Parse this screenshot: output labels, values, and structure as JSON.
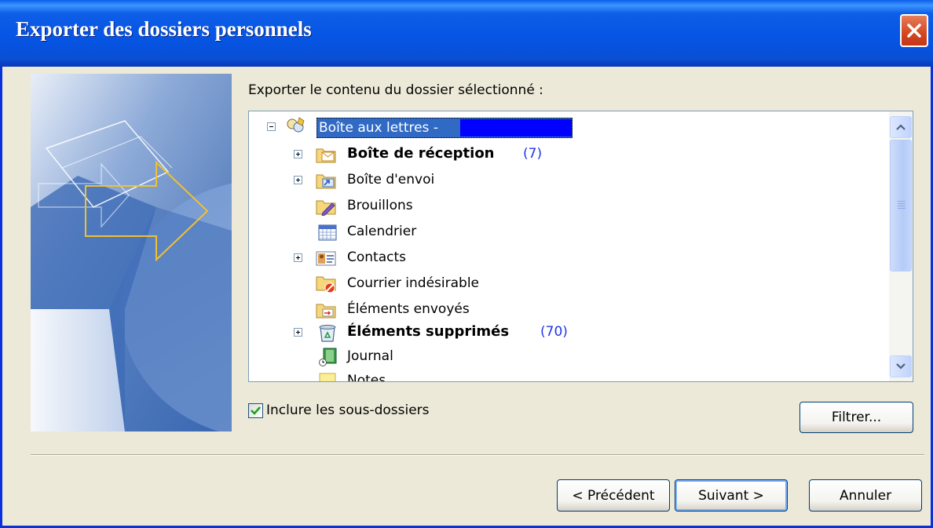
{
  "dialog": {
    "title": "Exporter des dossiers personnels",
    "prompt": "Exporter le contenu du dossier sélectionné :"
  },
  "tree": {
    "root_label": "Boîte aux lettres -",
    "items": [
      {
        "label": "Boîte de réception",
        "count": "(7)",
        "bold": true,
        "expandable": true,
        "icon": "inbox-folder-icon"
      },
      {
        "label": "Boîte d'envoi",
        "count": "",
        "bold": false,
        "expandable": true,
        "icon": "outbox-folder-icon"
      },
      {
        "label": "Brouillons",
        "count": "",
        "bold": false,
        "expandable": false,
        "icon": "drafts-folder-icon"
      },
      {
        "label": "Calendrier",
        "count": "",
        "bold": false,
        "expandable": false,
        "icon": "calendar-icon"
      },
      {
        "label": "Contacts",
        "count": "",
        "bold": false,
        "expandable": true,
        "icon": "contacts-icon"
      },
      {
        "label": "Courrier indésirable",
        "count": "",
        "bold": false,
        "expandable": false,
        "icon": "junk-mail-folder-icon"
      },
      {
        "label": "Éléments envoyés",
        "count": "",
        "bold": false,
        "expandable": false,
        "icon": "sent-items-folder-icon"
      },
      {
        "label": "Éléments supprimés",
        "count": "(70)",
        "bold": true,
        "expandable": true,
        "icon": "deleted-items-icon"
      },
      {
        "label": "Journal",
        "count": "",
        "bold": false,
        "expandable": false,
        "icon": "journal-icon"
      },
      {
        "label": "Notes",
        "count": "",
        "bold": false,
        "expandable": false,
        "icon": "notes-folder-icon"
      }
    ]
  },
  "options": {
    "include_subfolders_label": "Inclure les sous-dossiers",
    "include_subfolders_checked": true
  },
  "buttons": {
    "filter": "Filtrer...",
    "back": "< Précédent",
    "next": "Suivant >",
    "cancel": "Annuler"
  },
  "colors": {
    "titlebar": "#0554e3",
    "selection": "#316ac5",
    "count_text": "#1e36e8",
    "redaction": "#0000ff"
  }
}
